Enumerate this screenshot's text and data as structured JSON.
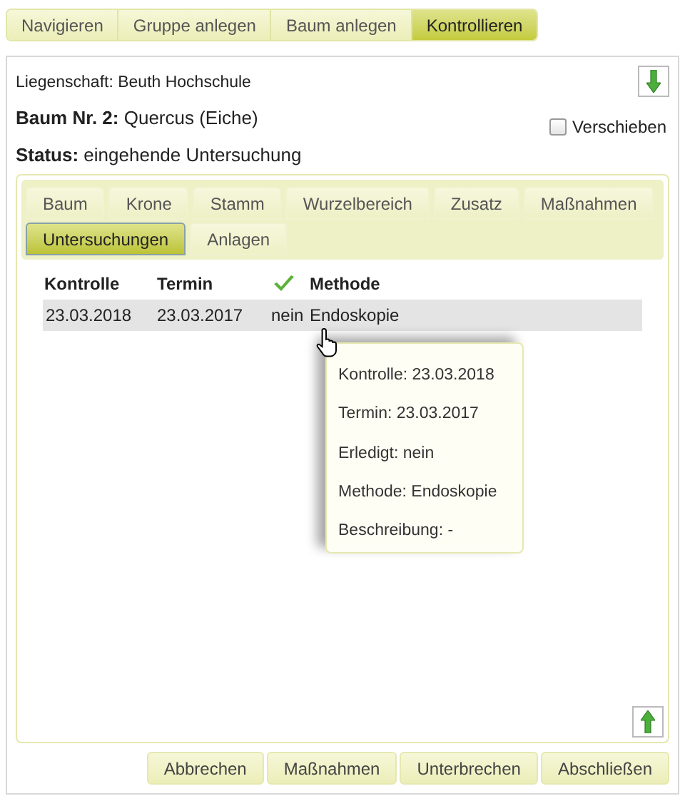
{
  "nav_tabs": [
    {
      "label": "Navigieren",
      "selected": false
    },
    {
      "label": "Gruppe anlegen",
      "selected": false
    },
    {
      "label": "Baum anlegen",
      "selected": false
    },
    {
      "label": "Kontrollieren",
      "selected": true
    }
  ],
  "property": "Liegenschaft: Beuth Hochschule",
  "tree": {
    "label": "Baum Nr. 2:",
    "value": "Quercus (Eiche)"
  },
  "move_checkbox": {
    "label": "Verschieben",
    "checked": false
  },
  "status": {
    "label": "Status:",
    "value": "eingehende Untersuchung"
  },
  "detail_tabs": [
    {
      "label": "Baum",
      "selected": false
    },
    {
      "label": "Krone",
      "selected": false
    },
    {
      "label": "Stamm",
      "selected": false
    },
    {
      "label": "Wurzelbereich",
      "selected": false
    },
    {
      "label": "Zusatz",
      "selected": false
    },
    {
      "label": "Maßnahmen",
      "selected": false
    },
    {
      "label": "Untersuchungen",
      "selected": true
    },
    {
      "label": "Anlagen",
      "selected": false
    }
  ],
  "table": {
    "columns": [
      {
        "kind": "text",
        "label": "Kontrolle"
      },
      {
        "kind": "text",
        "label": "Termin"
      },
      {
        "kind": "check_icon"
      },
      {
        "kind": "text",
        "label": "Methode"
      }
    ],
    "rows": [
      {
        "cells": [
          "23.03.2018",
          "23.03.2017",
          "nein",
          "Endoskopie"
        ],
        "selected": true
      }
    ]
  },
  "tooltip": [
    "Kontrolle: 23.03.2018",
    "Termin: 23.03.2017",
    "Erledigt: nein",
    "Methode: Endoskopie",
    "Beschreibung: -"
  ],
  "buttons": [
    "Abbrechen",
    "Maßnahmen",
    "Unterbrechen",
    "Abschließen"
  ]
}
